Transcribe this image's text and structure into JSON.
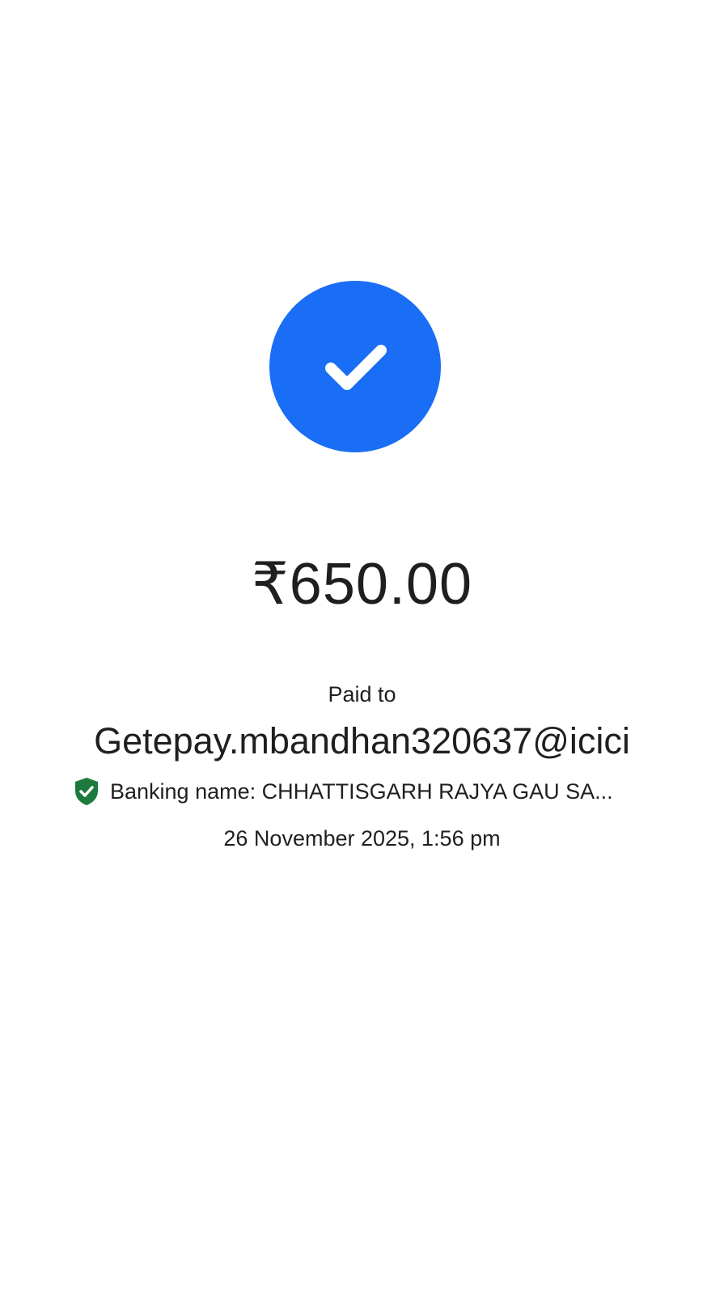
{
  "payment": {
    "status_icon": "check-circle-icon",
    "amount": "₹650.00",
    "paid_to_label": "Paid to",
    "payee_vpa": "Getepay.mbandhan320637@icici",
    "banking_name_text": "Banking name: CHHATTISGARH RAJYA GAU SA...",
    "verified_icon": "verified-shield-icon",
    "timestamp": "26 November 2025, 1:56 pm"
  },
  "colors": {
    "accent": "#1a6ef5",
    "verified": "#1e7a3c",
    "text": "#1f1f1f",
    "background": "#ffffff"
  }
}
